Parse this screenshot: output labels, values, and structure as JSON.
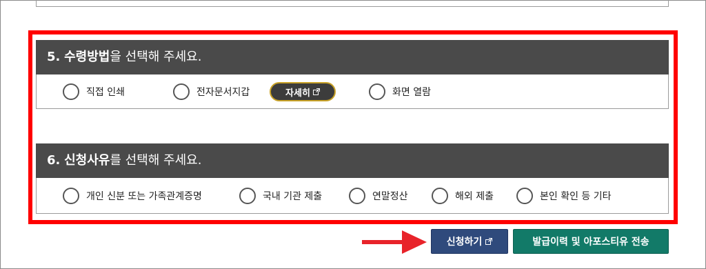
{
  "section5": {
    "number": "5.",
    "title_strong": "수령방법",
    "title_rest": "을 선택해 주세요.",
    "options": [
      "직접 인쇄",
      "전자문서지갑",
      "화면 열람"
    ],
    "detail_button": "자세히"
  },
  "section6": {
    "number": "6.",
    "title_strong": "신청사유",
    "title_rest": "를 선택해 주세요.",
    "options": [
      "개인 신분 또는 가족관계증명",
      "국내 기관 제출",
      "연말정산",
      "해외 제출",
      "본인 확인 등 기타"
    ]
  },
  "buttons": {
    "apply": "신청하기",
    "history": "발급이력 및 아포스티유 전송"
  },
  "colors": {
    "highlight": "#ff0000",
    "header_bg": "#4a4a4a",
    "apply_bg": "#2f4a7c",
    "history_bg": "#127a68",
    "arrow": "#e8232a",
    "detail_border": "#c9a227"
  },
  "icons": [
    "external-link-icon",
    "arrow-right-icon"
  ]
}
